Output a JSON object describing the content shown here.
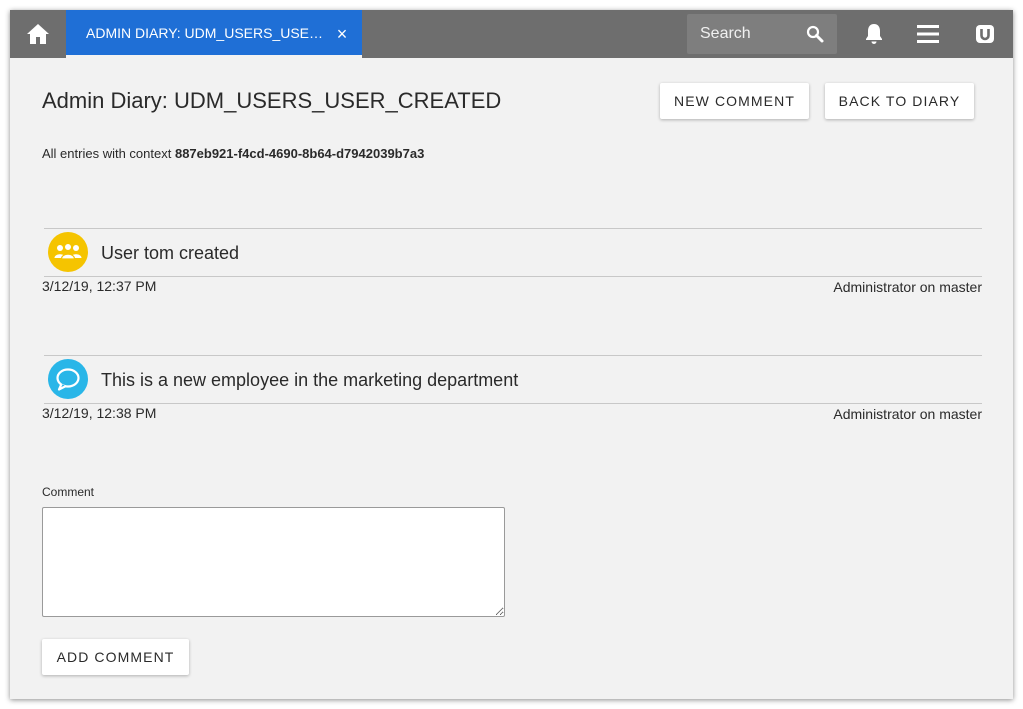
{
  "topbar": {
    "tab_label": "ADMIN DIARY: UDM_USERS_USER_CREATED",
    "tab_close": "×",
    "search_placeholder": "Search"
  },
  "page": {
    "title": "Admin Diary: UDM_USERS_USER_CREATED",
    "new_comment_label": "NEW COMMENT",
    "back_label": "BACK TO DIARY",
    "context_prefix": "All entries with context",
    "context_id": "887eb921-f4cd-4690-8b64-d7942039b7a3"
  },
  "entries": [
    {
      "icon": "users-icon",
      "icon_color": "#f5c400",
      "message": "User tom created",
      "timestamp": "3/12/19, 12:37 PM",
      "author": "Administrator on master"
    },
    {
      "icon": "comment-icon",
      "icon_color": "#29b6e8",
      "message": "This is a new employee in the marketing department",
      "timestamp": "3/12/19, 12:38 PM",
      "author": "Administrator on master"
    }
  ],
  "comment_form": {
    "label": "Comment",
    "value": "",
    "submit_label": "ADD COMMENT"
  },
  "colors": {
    "topbar": "#6e6e6e",
    "active_tab": "#1f6fd6",
    "background": "#f2f2f2"
  }
}
